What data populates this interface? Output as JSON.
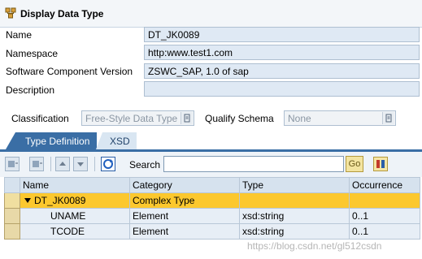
{
  "header": {
    "title": "Display Data Type"
  },
  "form": {
    "name_label": "Name",
    "name_value": "DT_JK0089",
    "namespace_label": "Namespace",
    "namespace_value": "http:www.test1.com",
    "swcv_label": "Software Component Version",
    "swcv_value": "ZSWC_SAP, 1.0 of sap",
    "description_label": "Description",
    "description_value": "",
    "classification_label": "Classification",
    "classification_value": "Free-Style Data Type",
    "qualify_label": "Qualify Schema",
    "qualify_value": "None"
  },
  "tabs": [
    {
      "label": "Type Definition",
      "active": true
    },
    {
      "label": "XSD",
      "active": false
    }
  ],
  "toolbar": {
    "search_label": "Search",
    "search_value": "",
    "go_label": "Go"
  },
  "grid": {
    "columns": [
      "Name",
      "Category",
      "Type",
      "Occurrence"
    ],
    "rows": [
      {
        "name": "DT_JK0089",
        "category": "Complex Type",
        "type": "",
        "occurrence": "",
        "expanded": true
      },
      {
        "name": "UNAME",
        "category": "Element",
        "type": "xsd:string",
        "occurrence": "0..1"
      },
      {
        "name": "TCODE",
        "category": "Element",
        "type": "xsd:string",
        "occurrence": "0..1"
      }
    ]
  },
  "watermark": "https://blog.csdn.net/gl512csdn",
  "colors": {
    "tab_active": "#3a6ea5",
    "row_highlight": "#fcc82e",
    "field_bg": "#dfe9f4"
  }
}
